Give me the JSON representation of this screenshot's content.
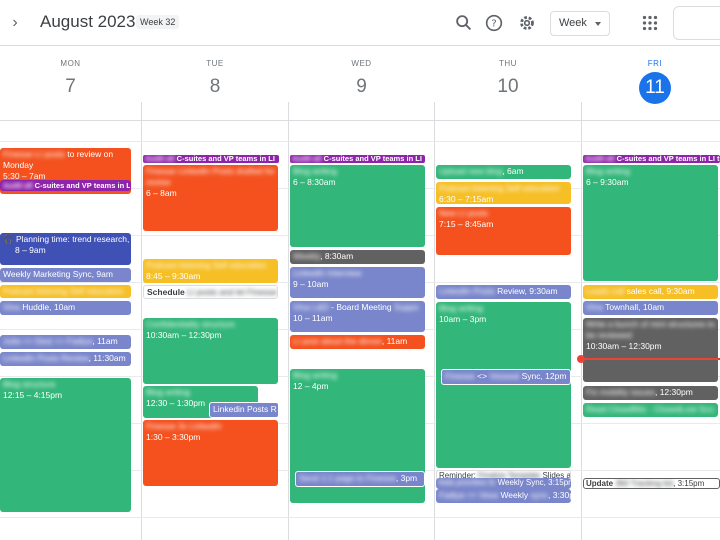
{
  "header": {
    "month_title": "August 2023",
    "week_badge": "Week 32",
    "view_label": "Week",
    "icons": [
      "chevron-right-icon",
      "search-icon",
      "help-icon",
      "gear-icon",
      "apps-grid-icon"
    ]
  },
  "days": [
    {
      "name": "MON",
      "num": "7"
    },
    {
      "name": "TUE",
      "num": "8"
    },
    {
      "name": "WED",
      "num": "9"
    },
    {
      "name": "THU",
      "num": "10"
    },
    {
      "name": "FRI",
      "num": "11",
      "today": true
    }
  ],
  "colors": {
    "orange": "#f4511e",
    "green": "#33b679",
    "lavender": "#7986cb",
    "navy": "#3f51b5",
    "yellow": "#f6bf26",
    "graphite": "#616161",
    "grape": "#8e24aa",
    "today_blue": "#1a73e8",
    "now_red": "#ea4335"
  },
  "events": {
    "mon": {
      "e1_blur": "Finesse LI posts",
      "e1_title": " to review on Monday",
      "e1_time": "5:30 – 7am",
      "e2_blur": "Audit all",
      "e2_title": " C-suites and VP teams in LI",
      "e3_title": "Planning time: trend research,",
      "e3_time": "8 – 9am",
      "e4_title": "Weekly Marketing Sync, 9am",
      "e5_blur": "Podcast listening Self education",
      "e6_blur": "Vina",
      "e6_title": " Huddle, 10am",
      "e7_blur": "Julia <> Desi <> Fadiya",
      "e7_title": ", 11am",
      "e8_blur": "LinkedIn Posts Review",
      "e8_title": ", 11:30am",
      "e9_blur": "Blog structure",
      "e9_time": "12:15 – 4:15pm"
    },
    "tue": {
      "bar_blur": "Audit all",
      "bar_title": " C-suites and VP teams in LI",
      "e1_blur": "Finesse LinkedIn Posts drafted for review",
      "e1_time": "6 – 8am",
      "e2_blur": "Podcast listening Self education",
      "e2_time": "8:45 – 9:30am",
      "e3_title": "Schedule",
      "e3_blur": " LI posts and let Finesse",
      "e3_tail": " k",
      "e4_blur": "Confidentiality structure",
      "e4_time": "10:30am – 12:30pm",
      "e5_blur": "Blog writing",
      "e5_time": "12:30 – 1:30pm",
      "e6_title": "Linkedin Posts R",
      "e7_blur": "Finesse 3x LinkedIn",
      "e7_time": "1:30 – 3:30pm"
    },
    "wed": {
      "bar_blur": "Audit all",
      "bar_title": " C-suites and VP teams in LI",
      "e1_blur": "Blog writing",
      "e1_time": "6 – 8:30am",
      "e2_blur": "Weekly",
      "e2_title": ", 8:30am",
      "e3_blur": "LinkedIn Interview",
      "e3_time": "9 – 10am",
      "e4_blur": "Vina L&D",
      "e4_title": " - Board Meeting",
      "e4_tail": " Suppo",
      "e4_time": "10 – 11am",
      "e5_blur": "LI post about the dinner",
      "e5_title": ", 11am",
      "e6_blur": "Blog writing",
      "e6_time": "12 – 4pm",
      "e7_blur": "Send 1:1 page to Finesse",
      "e7_title": ", 3pm"
    },
    "thu": {
      "e1_blur": "Upload new blog",
      "e1_title": ", 6am",
      "e2_blur": "Podcast listening Self education",
      "e2_time": "6:30 – 7:15am",
      "e3_blur": "New LI posts",
      "e3_time": "7:15 – 8:45am",
      "e4_blur": "LinkedIn Posts",
      "e4_title": " Review, 9:30am",
      "e5_blur": "Blog writing",
      "e5_time": "10am – 3pm",
      "e6_blur": "Finesse",
      "e6_title": " <> ",
      "e6_blur2": "Vesseal",
      "e6_title2": " Sync, 12pm",
      "e7_title": "Reminder: ",
      "e7_blur": "Finalize Template",
      "e7_title2": " Slides at",
      "e8_blur": "Aida priorities fo",
      "e8_title": " Weekly Sync, 3:15pm",
      "e9_blur": "Fadiya <> Vesa",
      "e9_title": " Weekly ",
      "e9_blur2": "sync",
      "e9_title2": ", 3:30pm"
    },
    "fri": {
      "bar_blur": "Audit all",
      "bar_title": " C-suites and VP teams in LI to",
      "e1_blur": "Blog writing",
      "e1_time": "6 – 9:30am",
      "e2_blur": "Leads call",
      "e2_title": " sales call, 9:30am",
      "e3_blur": "Vina",
      "e3_title": " Townhall, 10am",
      "e4_blur": "Write a bunch of mini structures to be reviewed",
      "e4_time": "10:30am – 12:30pm",
      "e5_blur": "Fix mobility issues",
      "e5_title": ", 12:30pm",
      "e6_blur": "Read CloseBlitz - ClosedLost Sco",
      "e7_title": "Update",
      "e7_blur": " 360 Tracking list",
      "e7_title2": ", 3:15pm"
    }
  }
}
